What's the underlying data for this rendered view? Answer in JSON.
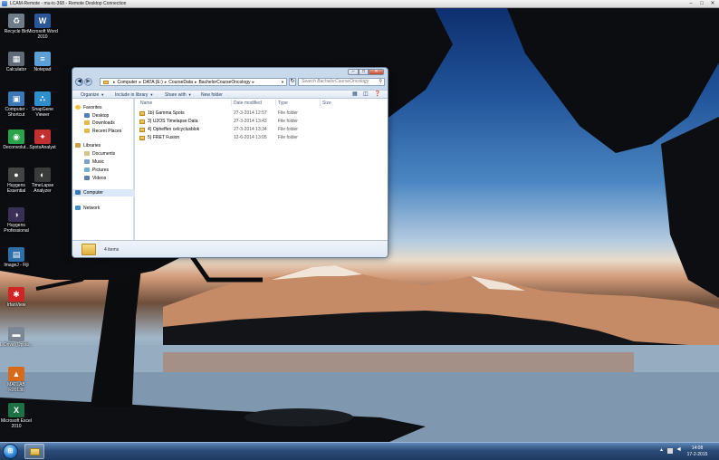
{
  "rdp_window": {
    "title": "LCAM-Remote - mu-tc-368 - Remote Desktop Connection",
    "controls": [
      "–",
      "□",
      "✕"
    ]
  },
  "desktop_icons": [
    {
      "label": "Recycle Bin",
      "icon": "recycle-bin-icon",
      "glyph": "♻",
      "color": "#6e7c8a"
    },
    {
      "label": "Microsoft Word 2010",
      "icon": "word-icon",
      "glyph": "W",
      "color": "#2b5797"
    },
    {
      "label": "Calculator",
      "icon": "calculator-icon",
      "glyph": "▦",
      "color": "#5f6b78"
    },
    {
      "label": "Notepad",
      "icon": "notepad-icon",
      "glyph": "≡",
      "color": "#5ca0d6"
    },
    {
      "label": "Computer - Shortcut",
      "icon": "computer-icon",
      "glyph": "▣",
      "color": "#3c77b6"
    },
    {
      "label": "SnapGene Viewer",
      "icon": "snapgene-icon",
      "glyph": "∴",
      "color": "#2f8fcc"
    },
    {
      "label": "Deconvolut...",
      "icon": "deconvolution-icon",
      "glyph": "◉",
      "color": "#2ba34b"
    },
    {
      "label": "SpotsAnalyst",
      "icon": "spots-analyst-icon",
      "glyph": "✦",
      "color": "#c23030"
    },
    {
      "label": "Huygens Essential",
      "icon": "huygens-essential-icon",
      "glyph": "●",
      "color": "#444444"
    },
    {
      "label": "TimeLapse Analyzer",
      "icon": "timelapse-analyzer-icon",
      "glyph": "◐",
      "color": "#3b3b3b"
    },
    {
      "label": "Huygens Professional",
      "icon": "huygens-professional-icon",
      "glyph": "◑",
      "color": "#3a2f55"
    },
    {
      "label": "ImageJ - Fiji",
      "icon": "imagej-icon",
      "glyph": "▤",
      "color": "#2f6fa8"
    },
    {
      "label": "IrfanView",
      "icon": "irfanview-icon",
      "glyph": "✱",
      "color": "#d12525"
    },
    {
      "label": "L Drive (Opsla...",
      "icon": "network-drive-icon",
      "glyph": "▬",
      "color": "#7b8794"
    },
    {
      "label": "MATLAB R2013b",
      "icon": "matlab-icon",
      "glyph": "▲",
      "color": "#d86a1c"
    },
    {
      "label": "Microsoft Excel 2010",
      "icon": "excel-icon",
      "glyph": "X",
      "color": "#1e7145"
    }
  ],
  "explorer": {
    "window_controls": [
      "–",
      "□",
      "✕"
    ],
    "nav_back": "◀",
    "nav_forward": "▶",
    "breadcrumbs": [
      "Computer",
      "DATA (E:)",
      "CourseData",
      "BachelorCourseOncology"
    ],
    "breadcrumb_separator": "▸",
    "refresh_glyph": "↻",
    "search_placeholder": "Search BachelorCourseOncology",
    "toolbar": {
      "organize": "Organize",
      "include_in_library": "Include in library",
      "share_with": "Share with",
      "new_folder": "New folder"
    },
    "nav_pane": {
      "favorites": "Favorites",
      "desktop": "Desktop",
      "downloads": "Downloads",
      "recent_places": "Recent Places",
      "libraries": "Libraries",
      "documents": "Documents",
      "music": "Music",
      "pictures": "Pictures",
      "videos": "Videos",
      "computer": "Computer",
      "network": "Network"
    },
    "columns": {
      "name": "Name",
      "date_modified": "Date modified",
      "type": "Type",
      "size": "Size"
    },
    "files": [
      {
        "name": "1b) Gamma Spots",
        "date": "27-3-2014 12:57",
        "type": "File folder"
      },
      {
        "name": "3) U2OS Timelapse Data",
        "date": "27-3-2014 13:43",
        "type": "File folder"
      },
      {
        "name": "4) Opheffen celcyclusblok",
        "date": "27-3-2014 13:34",
        "type": "File folder"
      },
      {
        "name": "5) FRET Fusion",
        "date": "12-6-2014 13:05",
        "type": "File folder"
      }
    ],
    "item_count": "4 items"
  },
  "taskbar": {
    "start_glyph": "⊞",
    "tray_arrow": "▲",
    "volume_glyph": "◄",
    "time": "14:08",
    "date": "17-2-2015"
  }
}
